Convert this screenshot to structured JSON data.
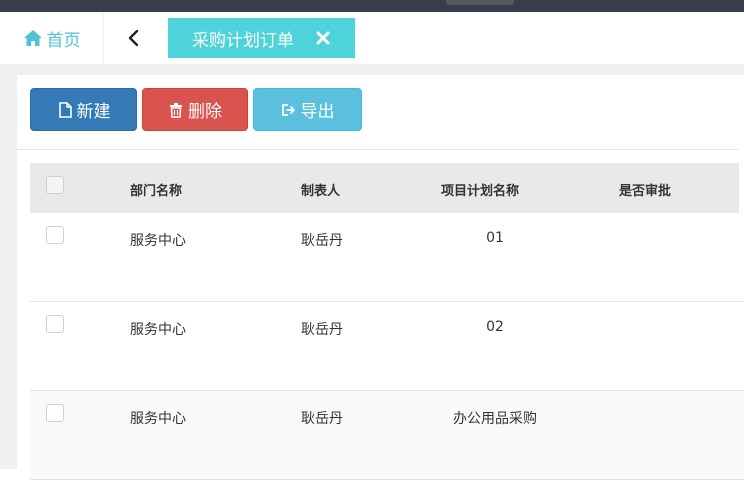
{
  "tabs": {
    "home_label": "首页",
    "active_label": "采购计划订单",
    "icons": {
      "home": "home-icon",
      "back": "chevron-left-icon",
      "close": "close-icon"
    }
  },
  "toolbar": {
    "new_label": "新建",
    "delete_label": "删除",
    "export_label": "导出",
    "icons": {
      "new": "file-icon",
      "delete": "trash-icon",
      "export": "export-icon"
    }
  },
  "colors": {
    "accent": "#4fd3db",
    "primary": "#337ab7",
    "danger": "#d9534f",
    "info": "#5bc0de"
  },
  "table": {
    "headers": {
      "dept": "部门名称",
      "maker": "制表人",
      "project": "项目计划名称",
      "approved": "是否审批"
    },
    "rows": [
      {
        "dept": "服务中心",
        "maker": "耿岳丹",
        "project": "01",
        "approved": ""
      },
      {
        "dept": "服务中心",
        "maker": "耿岳丹",
        "project": "02",
        "approved": ""
      },
      {
        "dept": "服务中心",
        "maker": "耿岳丹",
        "project": "办公用品采购",
        "approved": ""
      }
    ]
  }
}
